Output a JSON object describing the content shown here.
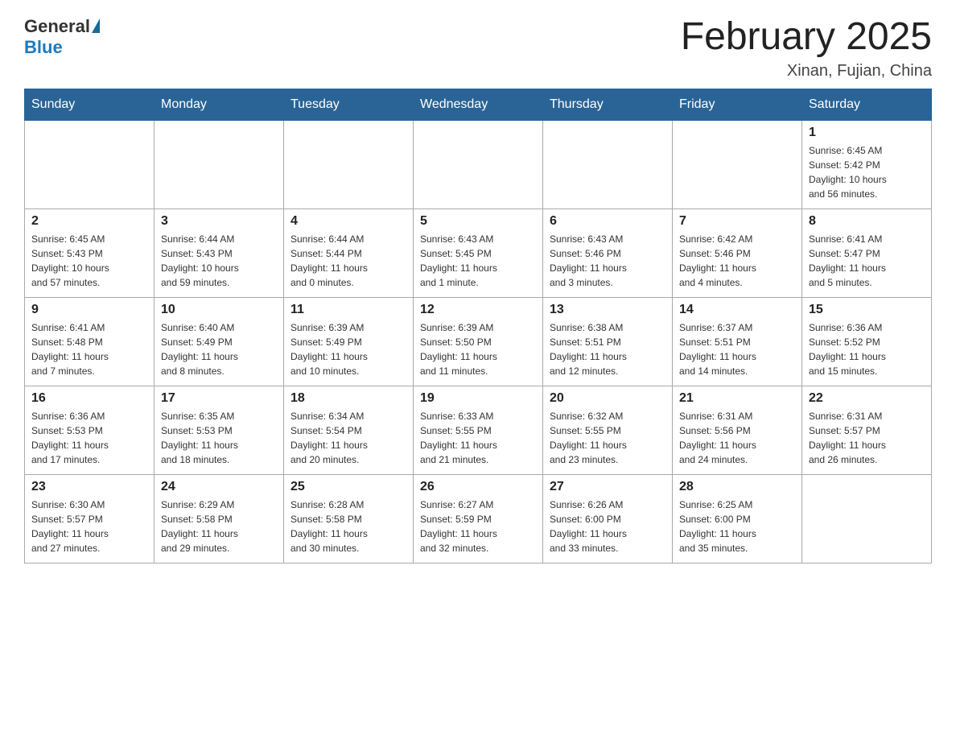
{
  "header": {
    "logo_general": "General",
    "logo_blue": "Blue",
    "month_title": "February 2025",
    "location": "Xinan, Fujian, China"
  },
  "weekdays": [
    "Sunday",
    "Monday",
    "Tuesday",
    "Wednesday",
    "Thursday",
    "Friday",
    "Saturday"
  ],
  "weeks": [
    [
      {
        "day": "",
        "info": ""
      },
      {
        "day": "",
        "info": ""
      },
      {
        "day": "",
        "info": ""
      },
      {
        "day": "",
        "info": ""
      },
      {
        "day": "",
        "info": ""
      },
      {
        "day": "",
        "info": ""
      },
      {
        "day": "1",
        "info": "Sunrise: 6:45 AM\nSunset: 5:42 PM\nDaylight: 10 hours\nand 56 minutes."
      }
    ],
    [
      {
        "day": "2",
        "info": "Sunrise: 6:45 AM\nSunset: 5:43 PM\nDaylight: 10 hours\nand 57 minutes."
      },
      {
        "day": "3",
        "info": "Sunrise: 6:44 AM\nSunset: 5:43 PM\nDaylight: 10 hours\nand 59 minutes."
      },
      {
        "day": "4",
        "info": "Sunrise: 6:44 AM\nSunset: 5:44 PM\nDaylight: 11 hours\nand 0 minutes."
      },
      {
        "day": "5",
        "info": "Sunrise: 6:43 AM\nSunset: 5:45 PM\nDaylight: 11 hours\nand 1 minute."
      },
      {
        "day": "6",
        "info": "Sunrise: 6:43 AM\nSunset: 5:46 PM\nDaylight: 11 hours\nand 3 minutes."
      },
      {
        "day": "7",
        "info": "Sunrise: 6:42 AM\nSunset: 5:46 PM\nDaylight: 11 hours\nand 4 minutes."
      },
      {
        "day": "8",
        "info": "Sunrise: 6:41 AM\nSunset: 5:47 PM\nDaylight: 11 hours\nand 5 minutes."
      }
    ],
    [
      {
        "day": "9",
        "info": "Sunrise: 6:41 AM\nSunset: 5:48 PM\nDaylight: 11 hours\nand 7 minutes."
      },
      {
        "day": "10",
        "info": "Sunrise: 6:40 AM\nSunset: 5:49 PM\nDaylight: 11 hours\nand 8 minutes."
      },
      {
        "day": "11",
        "info": "Sunrise: 6:39 AM\nSunset: 5:49 PM\nDaylight: 11 hours\nand 10 minutes."
      },
      {
        "day": "12",
        "info": "Sunrise: 6:39 AM\nSunset: 5:50 PM\nDaylight: 11 hours\nand 11 minutes."
      },
      {
        "day": "13",
        "info": "Sunrise: 6:38 AM\nSunset: 5:51 PM\nDaylight: 11 hours\nand 12 minutes."
      },
      {
        "day": "14",
        "info": "Sunrise: 6:37 AM\nSunset: 5:51 PM\nDaylight: 11 hours\nand 14 minutes."
      },
      {
        "day": "15",
        "info": "Sunrise: 6:36 AM\nSunset: 5:52 PM\nDaylight: 11 hours\nand 15 minutes."
      }
    ],
    [
      {
        "day": "16",
        "info": "Sunrise: 6:36 AM\nSunset: 5:53 PM\nDaylight: 11 hours\nand 17 minutes."
      },
      {
        "day": "17",
        "info": "Sunrise: 6:35 AM\nSunset: 5:53 PM\nDaylight: 11 hours\nand 18 minutes."
      },
      {
        "day": "18",
        "info": "Sunrise: 6:34 AM\nSunset: 5:54 PM\nDaylight: 11 hours\nand 20 minutes."
      },
      {
        "day": "19",
        "info": "Sunrise: 6:33 AM\nSunset: 5:55 PM\nDaylight: 11 hours\nand 21 minutes."
      },
      {
        "day": "20",
        "info": "Sunrise: 6:32 AM\nSunset: 5:55 PM\nDaylight: 11 hours\nand 23 minutes."
      },
      {
        "day": "21",
        "info": "Sunrise: 6:31 AM\nSunset: 5:56 PM\nDaylight: 11 hours\nand 24 minutes."
      },
      {
        "day": "22",
        "info": "Sunrise: 6:31 AM\nSunset: 5:57 PM\nDaylight: 11 hours\nand 26 minutes."
      }
    ],
    [
      {
        "day": "23",
        "info": "Sunrise: 6:30 AM\nSunset: 5:57 PM\nDaylight: 11 hours\nand 27 minutes."
      },
      {
        "day": "24",
        "info": "Sunrise: 6:29 AM\nSunset: 5:58 PM\nDaylight: 11 hours\nand 29 minutes."
      },
      {
        "day": "25",
        "info": "Sunrise: 6:28 AM\nSunset: 5:58 PM\nDaylight: 11 hours\nand 30 minutes."
      },
      {
        "day": "26",
        "info": "Sunrise: 6:27 AM\nSunset: 5:59 PM\nDaylight: 11 hours\nand 32 minutes."
      },
      {
        "day": "27",
        "info": "Sunrise: 6:26 AM\nSunset: 6:00 PM\nDaylight: 11 hours\nand 33 minutes."
      },
      {
        "day": "28",
        "info": "Sunrise: 6:25 AM\nSunset: 6:00 PM\nDaylight: 11 hours\nand 35 minutes."
      },
      {
        "day": "",
        "info": ""
      }
    ]
  ]
}
